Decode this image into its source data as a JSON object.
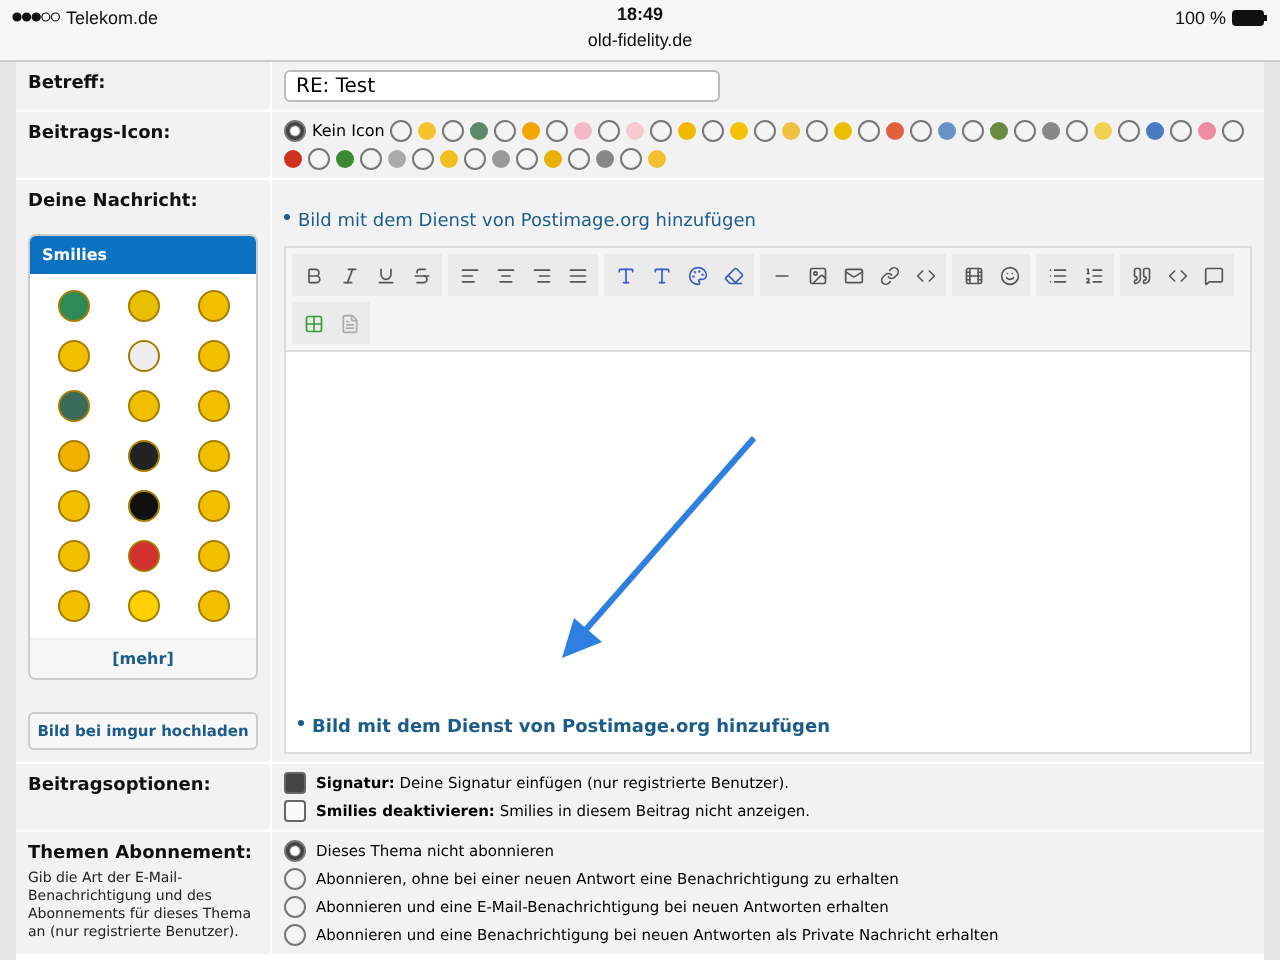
{
  "status_bar": {
    "carrier": "Telekom.de",
    "time": "18:49",
    "battery": "100 %",
    "url": "old-fidelity.de"
  },
  "subject": {
    "label": "Betreff:",
    "value": "RE: Test"
  },
  "post_icon": {
    "label": "Beitrags-Icon:",
    "none_label": "Kein Icon",
    "none_selected": true,
    "icons": [
      {
        "selected": false
      },
      {
        "selected": false
      },
      {
        "selected": false
      },
      {
        "selected": false
      },
      {
        "selected": false
      },
      {
        "selected": false
      },
      {
        "selected": false
      },
      {
        "selected": false
      },
      {
        "selected": false
      },
      {
        "selected": false
      },
      {
        "selected": false
      },
      {
        "selected": false
      },
      {
        "selected": false
      },
      {
        "selected": false
      },
      {
        "selected": false
      },
      {
        "selected": false
      },
      {
        "selected": false
      },
      {
        "selected": false
      },
      {
        "selected": false
      },
      {
        "selected": false
      },
      {
        "selected": false
      },
      {
        "selected": false
      },
      {
        "selected": false
      },
      {
        "selected": false
      }
    ]
  },
  "message": {
    "label": "Deine Nachricht:",
    "smilies_title": "Smilies",
    "more_link": "[mehr]",
    "imgur_button": "Bild bei imgur hochladen",
    "postimage_link": "Bild mit dem Dienst von Postimage.org hinzufügen",
    "editor_link": "Bild mit dem Dienst von Postimage.org hinzufügen"
  },
  "options": {
    "label": "Beitragsoptionen:",
    "items": [
      {
        "title": "Signatur:",
        "text": "Deine Signatur einfügen (nur registrierte Benutzer).",
        "checked": true
      },
      {
        "title": "Smilies deaktivieren:",
        "text": "Smilies in diesem Beitrag nicht anzeigen.",
        "checked": false
      }
    ]
  },
  "subscription": {
    "label": "Themen Abonnement:",
    "hint": "Gib die Art der E-Mail-Benachrichtigung und des Abonnements für dieses Thema an (nur registrierte Benutzer).",
    "choices": [
      {
        "label": "Dieses Thema nicht abonnieren",
        "selected": true
      },
      {
        "label": "Abonnieren, ohne bei einer neuen Antwort eine Benachrichtigung zu erhalten",
        "selected": false
      },
      {
        "label": "Abonnieren und eine E-Mail-Benachrichtigung bei neuen Antworten erhalten",
        "selected": false
      },
      {
        "label": "Abonnieren und eine Benachrichtigung bei neuen Antworten als Private Nachricht erhalten",
        "selected": false
      }
    ]
  }
}
